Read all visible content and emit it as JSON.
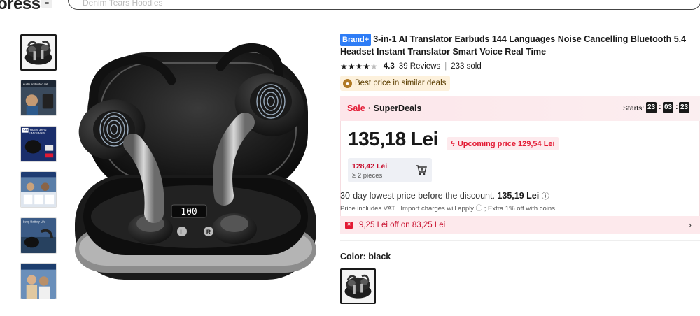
{
  "header": {
    "logo": "oress",
    "search_placeholder": "Denim Tears Hoodies"
  },
  "gallery": {
    "thumbnails": [
      {
        "label": ""
      },
      {
        "label": "Audio and video call"
      },
      {
        "label": "144 TRANSLATION LANGUAGES"
      },
      {
        "label": "Results"
      },
      {
        "label": "Long Battery Life"
      },
      {
        "label": "Translation"
      }
    ]
  },
  "product": {
    "brand_badge": "Brand+",
    "title": "3-in-1 AI Translator Earbuds 144 Languages Noise Cancelling Bluetooth 5.4 Headset Instant Translator Smart Voice Real Time",
    "rating_stars": 4.3,
    "rating_value": "4.3",
    "reviews": "39 Reviews",
    "sold": "233 sold",
    "best_price": "Best price in similar deals"
  },
  "sale": {
    "tag": "Sale",
    "title": "· SuperDeals",
    "starts_label": "Starts:",
    "countdown": [
      "23",
      "03",
      "23"
    ],
    "price": "135,18 Lei",
    "upcoming": "Upcoming price 129,54 Lei",
    "bulk_price": "128,42 Lei",
    "bulk_qty": "≥ 2 pieces"
  },
  "pricing": {
    "lowest_label": "30-day lowest price before the discount.",
    "lowest_value": "135,19 Lei",
    "vat_text": "Price includes VAT | Import charges will apply ⓘ ; Extra 1% off with coins",
    "coupon_text": "9,25 Lei off on 83,25 Lei"
  },
  "variant": {
    "color_label": "Color: black"
  },
  "colors": {
    "accent_red": "#e31933",
    "brand_blue": "#2e7df6",
    "sale_bg": "#fde6ea"
  }
}
